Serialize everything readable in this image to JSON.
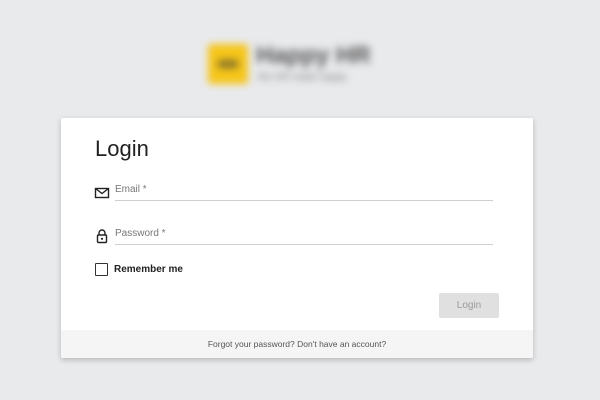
{
  "brand": {
    "name": "Happy HR",
    "tagline": "the HR made happy"
  },
  "login": {
    "title": "Login",
    "email_placeholder": "Email *",
    "password_placeholder": "Password *",
    "remember_label": "Remember me",
    "remember_checked": false,
    "submit_label": "Login",
    "submit_disabled": true
  },
  "footer": {
    "forgot_password": "Forgot your password?",
    "no_account": "Don't have an account?"
  },
  "colors": {
    "page_background": "#e9eaec",
    "card_background": "#ffffff",
    "logo_accent": "#f5c518",
    "disabled_button": "#e0e0e0"
  },
  "icons": {
    "email": "envelope-icon",
    "password": "lock-icon"
  }
}
